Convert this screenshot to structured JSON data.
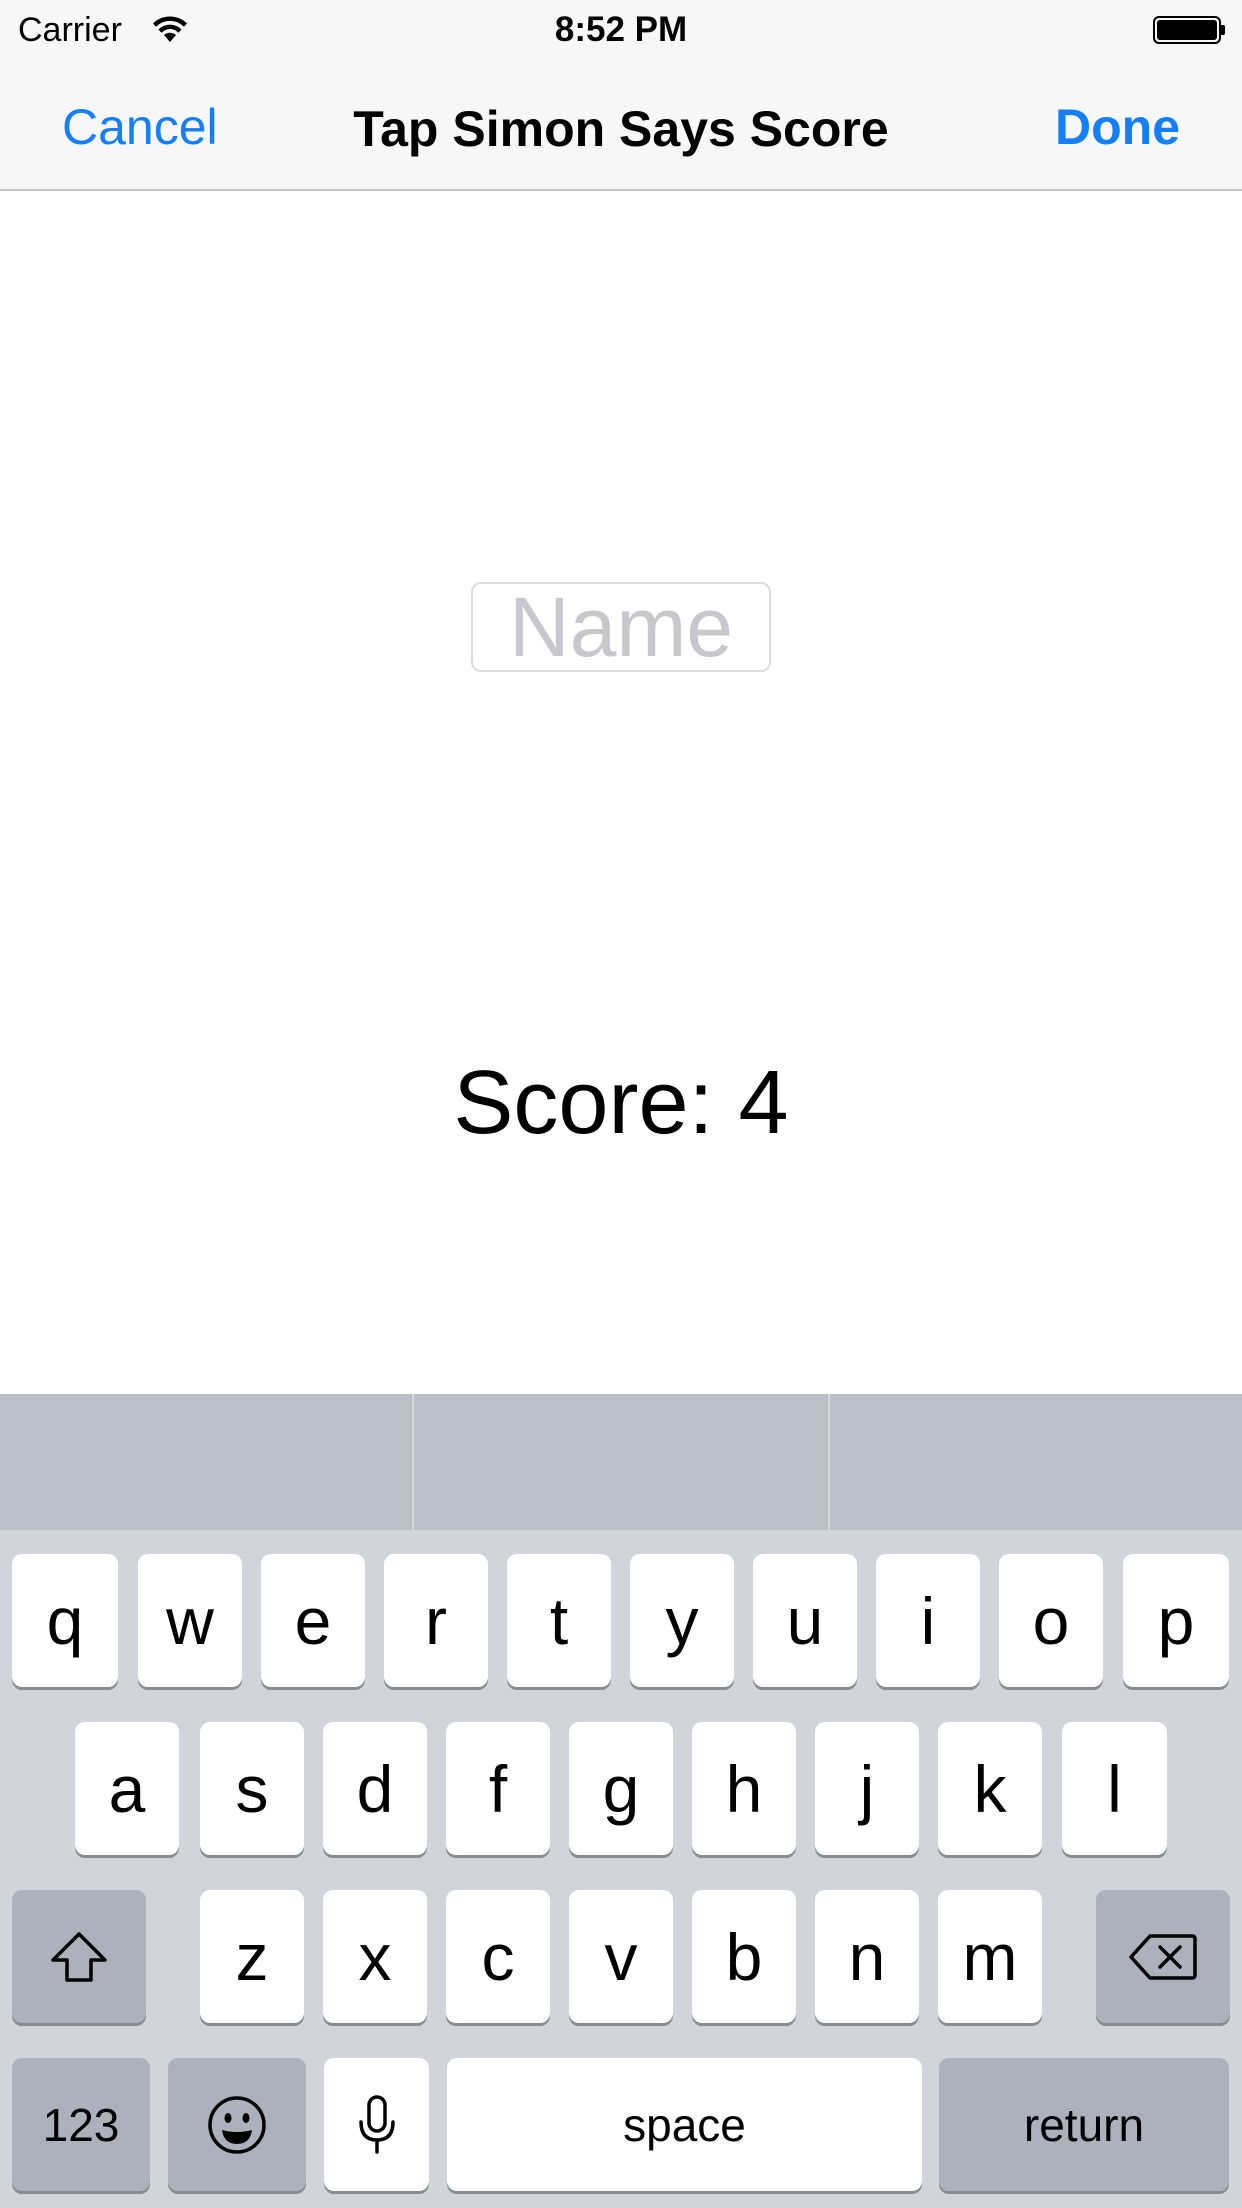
{
  "status_bar": {
    "carrier": "Carrier",
    "time": "8:52 PM",
    "wifi_icon": "wifi-icon",
    "battery_icon": "battery-icon"
  },
  "nav": {
    "cancel_label": "Cancel",
    "title": "Tap Simon Says Score",
    "done_label": "Done"
  },
  "form": {
    "name_placeholder": "Name",
    "name_value": "",
    "score_text": "Score: 4"
  },
  "keyboard": {
    "row1": [
      "q",
      "w",
      "e",
      "r",
      "t",
      "y",
      "u",
      "i",
      "o",
      "p"
    ],
    "row2": [
      "a",
      "s",
      "d",
      "f",
      "g",
      "h",
      "j",
      "k",
      "l"
    ],
    "row3": [
      "z",
      "x",
      "c",
      "v",
      "b",
      "n",
      "m"
    ],
    "numbers_label": "123",
    "space_label": "space",
    "return_label": "return",
    "shift_icon": "shift-icon",
    "delete_icon": "delete-icon",
    "emoji_icon": "emoji-icon",
    "mic_icon": "microphone-icon"
  },
  "colors": {
    "accent": "#147efb",
    "nav_background": "#f7f7f7",
    "keyboard_background": "#d1d4da",
    "key_background": "#ffffff",
    "dark_key_background": "#acb1bb",
    "predictive_bar_background": "#bbc0c8",
    "placeholder": "#c7c7cd"
  }
}
